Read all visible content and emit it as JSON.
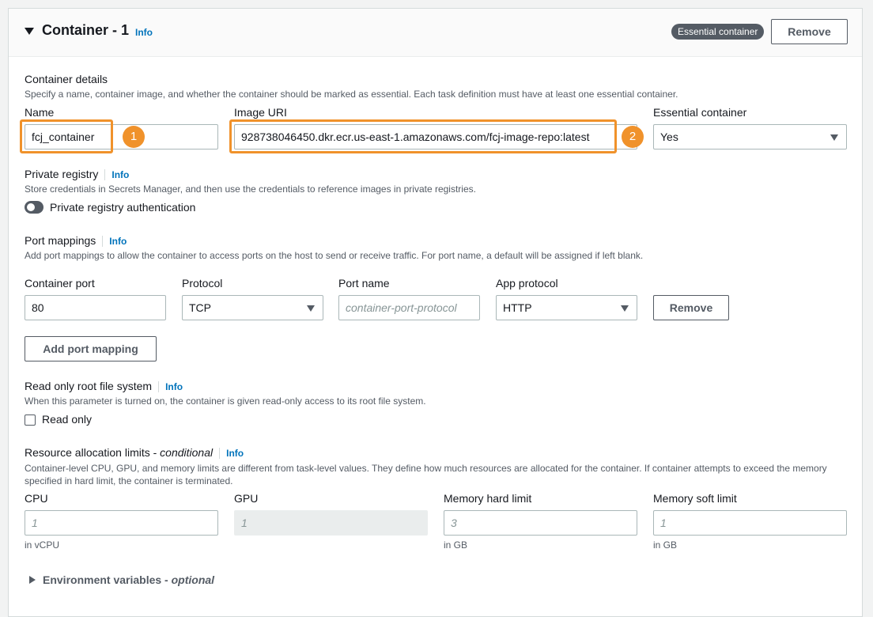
{
  "header": {
    "title": "Container - 1",
    "info": "Info",
    "badge": "Essential container",
    "remove_label": "Remove"
  },
  "container_details": {
    "title": "Container details",
    "description": "Specify a name, container image, and whether the container should be marked as essential. Each task definition must have at least one essential container.",
    "name_label": "Name",
    "name_value": "fcj_container",
    "image_label": "Image URI",
    "image_value": "928738046450.dkr.ecr.us-east-1.amazonaws.com/fcj-image-repo:latest",
    "essential_label": "Essential container",
    "essential_value": "Yes",
    "marker_1": "1",
    "marker_2": "2"
  },
  "private_registry": {
    "title": "Private registry",
    "info": "Info",
    "description": "Store credentials in Secrets Manager, and then use the credentials to reference images in private registries.",
    "toggle_label": "Private registry authentication"
  },
  "port_mappings": {
    "title": "Port mappings",
    "info": "Info",
    "description": "Add port mappings to allow the container to access ports on the host to send or receive traffic. For port name, a default will be assigned if left blank.",
    "container_port_label": "Container port",
    "container_port_value": "80",
    "protocol_label": "Protocol",
    "protocol_value": "TCP",
    "port_name_label": "Port name",
    "port_name_placeholder": "container-port-protocol",
    "app_protocol_label": "App protocol",
    "app_protocol_value": "HTTP",
    "remove_label": "Remove",
    "add_label": "Add port mapping"
  },
  "read_only": {
    "title": "Read only root file system",
    "info": "Info",
    "description": "When this parameter is turned on, the container is given read-only access to its root file system.",
    "checkbox_label": "Read only"
  },
  "resource_limits": {
    "title": "Resource allocation limits - ",
    "title_italic": "conditional",
    "info": "Info",
    "description": "Container-level CPU, GPU, and memory limits are different from task-level values. They define how much resources are allocated for the container. If container attempts to exceed the memory specified in hard limit, the container is terminated.",
    "cpu_label": "CPU",
    "cpu_placeholder": "1",
    "cpu_hint": "in vCPU",
    "gpu_label": "GPU",
    "gpu_placeholder": "1",
    "mem_hard_label": "Memory hard limit",
    "mem_hard_placeholder": "3",
    "mem_hard_hint": "in GB",
    "mem_soft_label": "Memory soft limit",
    "mem_soft_placeholder": "1",
    "mem_soft_hint": "in GB"
  },
  "env_vars": {
    "title": "Environment variables - ",
    "title_italic": "optional"
  }
}
